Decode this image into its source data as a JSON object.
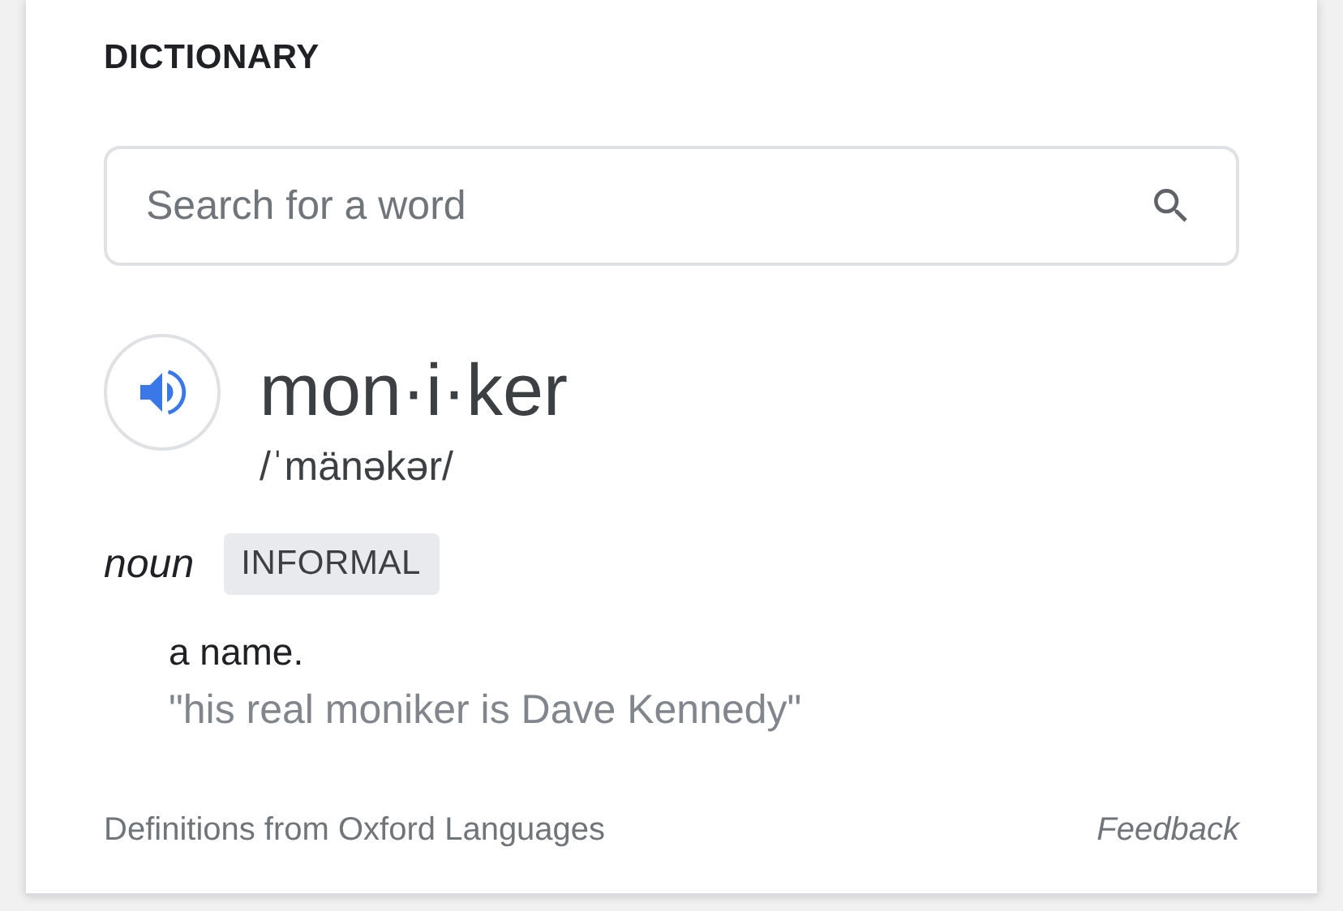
{
  "header": "DICTIONARY",
  "search": {
    "placeholder": "Search for a word"
  },
  "entry": {
    "word": "mon·i·ker",
    "phonetic": "/ˈmänəkər/",
    "senses": [
      {
        "part_of_speech": "noun",
        "label": "INFORMAL",
        "definition": "a name.",
        "example": "\"his real moniker is Dave Kennedy\""
      }
    ]
  },
  "footer": {
    "source": "Definitions from Oxford Languages",
    "feedback": "Feedback"
  }
}
